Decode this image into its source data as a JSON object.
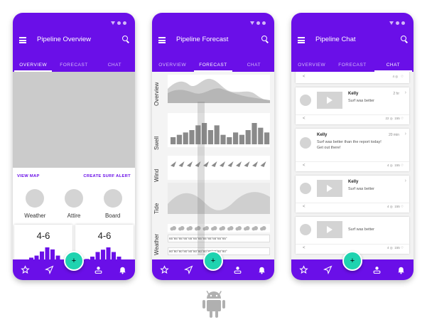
{
  "colors": {
    "primary": "#6a0fe8",
    "fab": "#1fd3b0",
    "placeholder": "#cbcbcb",
    "chart": "#6a0fe8"
  },
  "tabs": [
    "OVERVIEW",
    "FORECAST",
    "CHAT"
  ],
  "fab_label": "+",
  "nav_icons": [
    "star-icon",
    "navigation-icon",
    "plus-icon",
    "person-icon",
    "bell-icon"
  ],
  "phones": [
    {
      "title": "Pipeline Overview",
      "active_tab": 0
    },
    {
      "title": "Pipeline Forecast",
      "active_tab": 1
    },
    {
      "title": "Pipeline Chat",
      "active_tab": 2
    }
  ],
  "overview": {
    "view_map": "VIEW MAP",
    "create_alert": "CREATE SURF ALERT",
    "circles": [
      "Weather",
      "Attire",
      "Board"
    ],
    "cards": [
      {
        "value": "4-6",
        "bars": [
          2,
          3,
          4,
          5,
          7,
          9,
          8,
          5,
          3
        ]
      },
      {
        "value": "4-6",
        "bars": [
          2,
          3,
          4,
          6,
          7,
          8,
          6,
          4,
          2
        ]
      }
    ]
  },
  "forecast": {
    "rows": [
      "Overview",
      "Swell",
      "Wind",
      "Tide",
      "Weather"
    ],
    "swell_bars": [
      3,
      4,
      5,
      6,
      8,
      9,
      6,
      8,
      4,
      3,
      5,
      4,
      6,
      9,
      7,
      5
    ],
    "temps_1": "65°65°65°65°65°65°65°65°65°65°65°65°",
    "temps_2": "80°80°80°80°80°80°80°80°80°80°80°80°"
  },
  "chat": {
    "top_stats": "4",
    "messages": [
      {
        "name": "Kelly",
        "text": "Surf was better",
        "time": "2 hr",
        "comments": "22",
        "likes": "155",
        "video": true
      },
      {
        "name": "Kelly",
        "text": "Surf was better than the report today! Get out there!",
        "time": "20 min",
        "comments": "4",
        "likes": "155",
        "video": false
      },
      {
        "name": "Kelly",
        "text": "Surf was better",
        "time": "",
        "comments": "4",
        "likes": "155",
        "video": true
      },
      {
        "name": "",
        "text": "Surf was better",
        "time": "",
        "comments": "4",
        "likes": "155",
        "video": true
      }
    ]
  }
}
